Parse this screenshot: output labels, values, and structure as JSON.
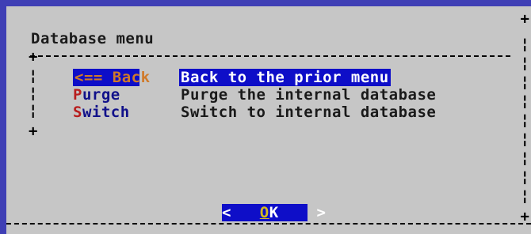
{
  "dialog": {
    "title": "Database menu",
    "menu": [
      {
        "tag": "<== Back",
        "description": "Back to the prior menu",
        "selected": true
      },
      {
        "tag_key": "P",
        "tag_rest": "urge",
        "description": "Purge the internal database"
      },
      {
        "tag_key": "S",
        "tag_rest": "witch",
        "description": "Switch to internal database"
      }
    ],
    "ok_button": {
      "left": "<",
      "key": "O",
      "rest": "K",
      "right": ">"
    }
  },
  "colors": {
    "background": "#3f3fb5",
    "dialog": "#c6c6c6",
    "highlight": "#0e0ec8",
    "hotkey": "#b81e1e",
    "tag_text": "#11118a"
  }
}
